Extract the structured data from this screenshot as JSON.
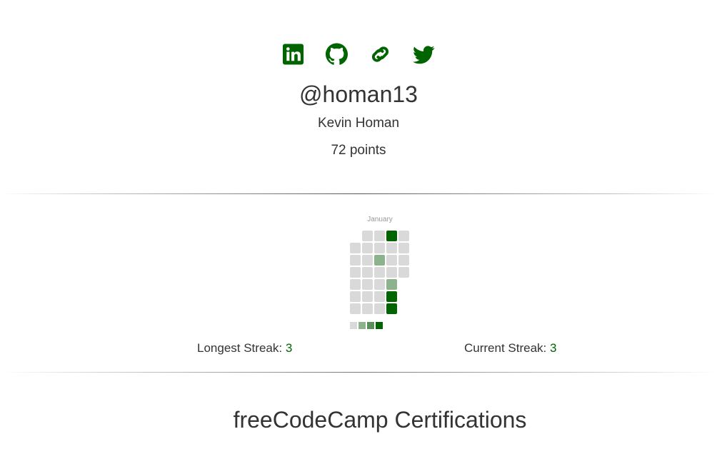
{
  "profile": {
    "social": [
      {
        "name": "linkedin-icon",
        "label": "LinkedIn"
      },
      {
        "name": "github-icon",
        "label": "GitHub"
      },
      {
        "name": "link-icon",
        "label": "Website"
      },
      {
        "name": "twitter-icon",
        "label": "Twitter"
      }
    ],
    "username": "@homan13",
    "full_name": "Kevin Homan",
    "points": "72 points"
  },
  "heatmap": {
    "month": "January",
    "colors": {
      "empty": "#d9d9d9",
      "level1": "#8cb38c",
      "level2": "#5a8f5a",
      "level3": "#006400"
    },
    "legend": [
      "#d9d9d9",
      "#8cb38c",
      "#5a8f5a",
      "#006400"
    ],
    "days": [
      {
        "col": 1,
        "row": 0,
        "level": 0
      },
      {
        "col": 2,
        "row": 0,
        "level": 0
      },
      {
        "col": 3,
        "row": 0,
        "level": 3
      },
      {
        "col": 4,
        "row": 0,
        "level": 0
      },
      {
        "col": 0,
        "row": 1,
        "level": 0
      },
      {
        "col": 1,
        "row": 1,
        "level": 0
      },
      {
        "col": 2,
        "row": 1,
        "level": 0
      },
      {
        "col": 3,
        "row": 1,
        "level": 0
      },
      {
        "col": 4,
        "row": 1,
        "level": 0
      },
      {
        "col": 0,
        "row": 2,
        "level": 0
      },
      {
        "col": 1,
        "row": 2,
        "level": 0
      },
      {
        "col": 2,
        "row": 2,
        "level": 1
      },
      {
        "col": 3,
        "row": 2,
        "level": 0
      },
      {
        "col": 4,
        "row": 2,
        "level": 0
      },
      {
        "col": 0,
        "row": 3,
        "level": 0
      },
      {
        "col": 1,
        "row": 3,
        "level": 0
      },
      {
        "col": 2,
        "row": 3,
        "level": 0
      },
      {
        "col": 3,
        "row": 3,
        "level": 0
      },
      {
        "col": 4,
        "row": 3,
        "level": 0
      },
      {
        "col": 0,
        "row": 4,
        "level": 0
      },
      {
        "col": 1,
        "row": 4,
        "level": 0
      },
      {
        "col": 2,
        "row": 4,
        "level": 0
      },
      {
        "col": 3,
        "row": 4,
        "level": 1
      },
      {
        "col": 0,
        "row": 5,
        "level": 0
      },
      {
        "col": 1,
        "row": 5,
        "level": 0
      },
      {
        "col": 2,
        "row": 5,
        "level": 0
      },
      {
        "col": 3,
        "row": 5,
        "level": 3
      },
      {
        "col": 0,
        "row": 6,
        "level": 0
      },
      {
        "col": 1,
        "row": 6,
        "level": 0
      },
      {
        "col": 2,
        "row": 6,
        "level": 0
      },
      {
        "col": 3,
        "row": 6,
        "level": 3
      }
    ]
  },
  "streaks": {
    "longest_label": "Longest Streak: ",
    "longest_value": "3",
    "current_label": "Current Streak: ",
    "current_value": "3"
  },
  "certifications": {
    "heading": "freeCodeCamp Certifications"
  },
  "accent_color": "#006400"
}
